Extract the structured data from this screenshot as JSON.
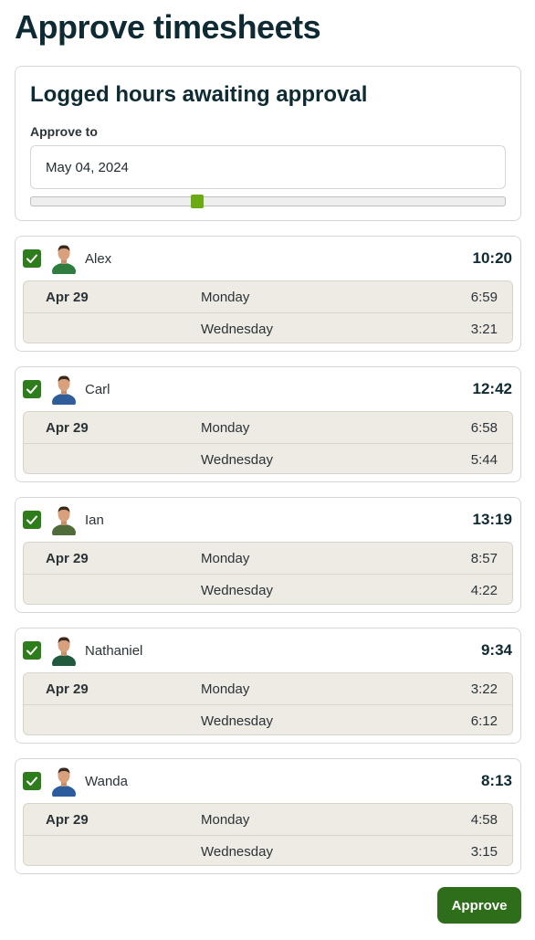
{
  "page": {
    "title": "Approve timesheets"
  },
  "filter": {
    "heading": "Logged hours awaiting approval",
    "label": "Approve to",
    "date_value": "May 04, 2024",
    "slider_fraction": 0.35
  },
  "users": [
    {
      "name": "Alex",
      "total": "10:20",
      "checked": true,
      "avatar_color": "#2e7d3e",
      "entries": [
        {
          "date": "Apr 29",
          "day": "Monday",
          "hours": "6:59"
        },
        {
          "date": "",
          "day": "Wednesday",
          "hours": "3:21"
        }
      ]
    },
    {
      "name": "Carl",
      "total": "12:42",
      "checked": true,
      "avatar_color": "#2f5d9a",
      "entries": [
        {
          "date": "Apr 29",
          "day": "Monday",
          "hours": "6:58"
        },
        {
          "date": "",
          "day": "Wednesday",
          "hours": "5:44"
        }
      ]
    },
    {
      "name": "Ian",
      "total": "13:19",
      "checked": true,
      "avatar_color": "#4f6b3a",
      "entries": [
        {
          "date": "Apr 29",
          "day": "Monday",
          "hours": "8:57"
        },
        {
          "date": "",
          "day": "Wednesday",
          "hours": "4:22"
        }
      ]
    },
    {
      "name": "Nathaniel",
      "total": "9:34",
      "checked": true,
      "avatar_color": "#1f5a3f",
      "entries": [
        {
          "date": "Apr 29",
          "day": "Monday",
          "hours": "3:22"
        },
        {
          "date": "",
          "day": "Wednesday",
          "hours": "6:12"
        }
      ]
    },
    {
      "name": "Wanda",
      "total": "8:13",
      "checked": true,
      "avatar_color": "#2b5c9e",
      "entries": [
        {
          "date": "Apr 29",
          "day": "Monday",
          "hours": "4:58"
        },
        {
          "date": "",
          "day": "Wednesday",
          "hours": "3:15"
        }
      ]
    }
  ],
  "actions": {
    "approve_label": "Approve"
  },
  "colors": {
    "accent": "#2e6e1a",
    "checkbox": "#2e7d1c",
    "slider": "#6aaa12",
    "entries_bg": "#eeebe4"
  }
}
